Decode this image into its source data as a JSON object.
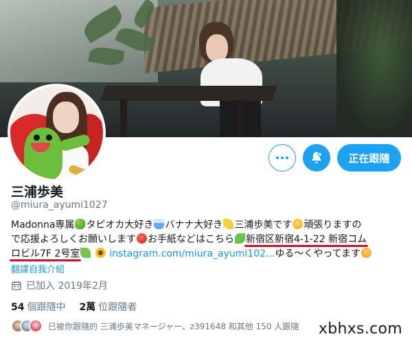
{
  "profile": {
    "name": "三浦歩美",
    "handle": "@miura_ayumi1027",
    "bio": {
      "line1": {
        "t1": "Madonna専属",
        "t2": "タピオカ大好き",
        "t3": "バナナ大好き",
        "t4": "三浦歩美です",
        "t5": "頑張りますの"
      },
      "line2": {
        "t1": "で応援よろしくお願いします",
        "t2": "お手紙などはこちら",
        "t3": "新宿区新宿4-1-22 新宿コム"
      },
      "line3": {
        "t1": "ロビル7F 2号室",
        "link": "instagram.com/miura_ayumi102...",
        "t2": "ゆる～くやってます"
      }
    },
    "translate_label": "翻譯自我介紹",
    "joined": "已加入 2019年2月",
    "following_count": "54",
    "following_label": "個跟隨中",
    "followers_count": "2萬",
    "followers_label": "位跟隨者",
    "followed_by": "已被你跟隨的 三浦歩美マネージャー、z391648 和其他 150 人跟隨"
  },
  "actions": {
    "follow_label": "正在跟隨",
    "more_icon": "more-icon",
    "bell_icon": "bell-icon"
  },
  "watermark": "xbhxs.com",
  "colors": {
    "accent": "#1da1f2",
    "link": "#1b95e0",
    "secondary_text": "#657786",
    "underline": "#c8102e"
  }
}
